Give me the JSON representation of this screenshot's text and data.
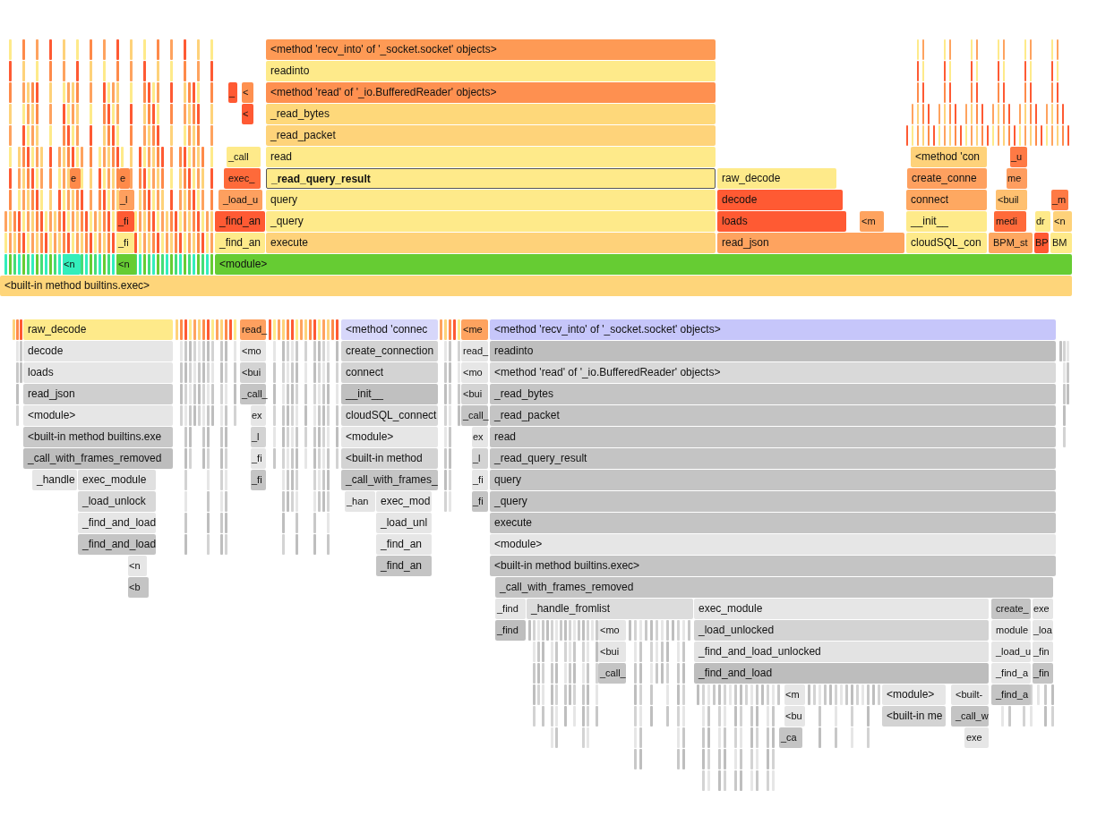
{
  "flame_graph": {
    "rows": [
      {
        "frames": [
          {
            "label": "<method 'recv_into' of '_socket.socket' objects>",
            "color": "#fe9a55",
            "selected": false
          }
        ]
      },
      {
        "frames": [
          {
            "label": "readinto",
            "color": "#feea8a",
            "selected": false
          }
        ]
      },
      {
        "frames": [
          {
            "label": "_",
            "color": "#ff5a33",
            "selected": false
          },
          {
            "label": "<",
            "color": "#fe9050",
            "selected": false
          },
          {
            "label": "<method 'read' of '_io.BufferedReader' objects>",
            "color": "#fe9050",
            "selected": false
          }
        ]
      },
      {
        "frames": [
          {
            "label": "<",
            "color": "#ff5a33",
            "selected": false
          },
          {
            "label": "_read_bytes",
            "color": "#fed87a",
            "selected": false
          }
        ]
      },
      {
        "frames": [
          {
            "label": "_read_packet",
            "color": "#fed37a",
            "selected": false
          }
        ]
      },
      {
        "frames": [
          {
            "label": "_call",
            "color": "#feea8a",
            "selected": false
          },
          {
            "label": "read",
            "color": "#feea8a",
            "selected": false
          },
          {
            "label": "<method 'con",
            "color": "#fed27a",
            "selected": false
          },
          {
            "label": "_u",
            "color": "#fe7a45",
            "selected": false
          }
        ]
      },
      {
        "frames": [
          {
            "label": "e",
            "color": "#fe8a4a",
            "selected": false
          },
          {
            "label": "e",
            "color": "#fe8a4a",
            "selected": false
          },
          {
            "label": "exec_",
            "color": "#fe6a3a",
            "selected": false
          },
          {
            "label": "_read_query_result",
            "color": "#feea8a",
            "selected": true
          },
          {
            "label": "raw_decode",
            "color": "#feea8a",
            "selected": false
          },
          {
            "label": "create_conne",
            "color": "#fea05f",
            "selected": false
          },
          {
            "label": "me",
            "color": "#fe9d5f",
            "selected": false
          }
        ]
      },
      {
        "frames": [
          {
            "label": "_l",
            "color": "#fea05f",
            "selected": false
          },
          {
            "label": "_load_u",
            "color": "#fea05f",
            "selected": false
          },
          {
            "label": "query",
            "color": "#feea8a",
            "selected": false
          },
          {
            "label": "decode",
            "color": "#ff5a33",
            "selected": false
          },
          {
            "label": "connect",
            "color": "#fea861",
            "selected": false
          },
          {
            "label": "<buil",
            "color": "#fec070",
            "selected": false
          },
          {
            "label": "_m",
            "color": "#fe7a45",
            "selected": false
          }
        ]
      },
      {
        "frames": [
          {
            "label": "_fi",
            "color": "#ff5a33",
            "selected": false
          },
          {
            "label": "_find_an",
            "color": "#ff5a33",
            "selected": false
          },
          {
            "label": "_query",
            "color": "#feea8a",
            "selected": false
          },
          {
            "label": "loads",
            "color": "#ff5a33",
            "selected": false
          },
          {
            "label": "<m",
            "color": "#fea35f",
            "selected": false
          },
          {
            "label": "__init__",
            "color": "#feea8a",
            "selected": false
          },
          {
            "label": "medi",
            "color": "#ff6a3a",
            "selected": false
          },
          {
            "label": "dr",
            "color": "#feea8a",
            "selected": false
          },
          {
            "label": "<n",
            "color": "#fed27a",
            "selected": false
          }
        ]
      },
      {
        "frames": [
          {
            "label": "_fi",
            "color": "#feea8a",
            "selected": false
          },
          {
            "label": "_find_an",
            "color": "#feea8a",
            "selected": false
          },
          {
            "label": "execute",
            "color": "#fed27a",
            "selected": false
          },
          {
            "label": "read_json",
            "color": "#fea35f",
            "selected": false
          },
          {
            "label": "cloudSQL_con",
            "color": "#feea8a",
            "selected": false
          },
          {
            "label": "BPM_st",
            "color": "#fea861",
            "selected": false
          },
          {
            "label": "BP",
            "color": "#ff5a33",
            "selected": false
          },
          {
            "label": "BM",
            "color": "#feea8a",
            "selected": false
          }
        ]
      },
      {
        "frames": [
          {
            "label": "<n",
            "color": "#33eebb",
            "selected": false
          },
          {
            "label": "<n",
            "color": "#66cc33",
            "selected": false
          },
          {
            "label": "<module>",
            "color": "#66cc33",
            "selected": false
          }
        ]
      },
      {
        "frames": [
          {
            "label": "<built-in method builtins.exec>",
            "color": "#fed57a",
            "selected": false
          }
        ]
      }
    ]
  },
  "icicle_graph": {
    "rows": [
      {
        "frames": [
          {
            "label": "raw_decode",
            "color": "#feea8a",
            "selected": false
          },
          {
            "label": "read_",
            "color": "#fea05f",
            "selected": false
          },
          {
            "label": "<method 'connec",
            "color": "#d7d7fa",
            "selected": false
          },
          {
            "label": "<me",
            "color": "#fea35f",
            "selected": false
          },
          {
            "label": "<method 'recv_into' of '_socket.socket' objects>",
            "color": "#c6c6fa",
            "selected": false
          }
        ]
      },
      {
        "frames": [
          {
            "label": "decode",
            "color": "#e6e6e6",
            "selected": false
          },
          {
            "label": "<mo",
            "color": "#e6e6e6",
            "selected": false
          },
          {
            "label": "create_connection",
            "color": "#d3d3d3",
            "selected": false
          },
          {
            "label": "read_",
            "color": "#e6e6e6",
            "selected": false
          },
          {
            "label": "readinto",
            "color": "#bebebe",
            "selected": false
          }
        ]
      },
      {
        "frames": [
          {
            "label": "loads",
            "color": "#e6e6e6",
            "selected": false
          },
          {
            "label": "<bui",
            "color": "#d3d3d3",
            "selected": false
          },
          {
            "label": "connect",
            "color": "#d3d3d3",
            "selected": false
          },
          {
            "label": "<mo",
            "color": "#e6e6e6",
            "selected": false
          },
          {
            "label": "<method 'read' of '_io.BufferedReader' objects>",
            "color": "#d9d9d9",
            "selected": false
          }
        ]
      },
      {
        "frames": [
          {
            "label": "read_json",
            "color": "#cfcfcf",
            "selected": false
          },
          {
            "label": "_call_",
            "color": "#c4c4c4",
            "selected": false
          },
          {
            "label": "__init__",
            "color": "#c0c0c0",
            "selected": false
          },
          {
            "label": "<bui",
            "color": "#d3d3d3",
            "selected": false
          },
          {
            "label": "_read_bytes",
            "color": "#c4c4c4",
            "selected": false
          }
        ]
      },
      {
        "frames": [
          {
            "label": "<module>",
            "color": "#e6e6e6",
            "selected": false
          },
          {
            "label": "ex",
            "color": "#e6e6e6",
            "selected": false
          },
          {
            "label": "cloudSQL_connect",
            "color": "#d8d8d8",
            "selected": false
          },
          {
            "label": "_call_",
            "color": "#c4c4c4",
            "selected": false
          },
          {
            "label": "_read_packet",
            "color": "#c4c4c4",
            "selected": false
          }
        ]
      },
      {
        "frames": [
          {
            "label": "<built-in method builtins.exe",
            "color": "#c8c8c8",
            "selected": false
          },
          {
            "label": "_l",
            "color": "#d3d3d3",
            "selected": false
          },
          {
            "label": "<module>",
            "color": "#e6e6e6",
            "selected": false
          },
          {
            "label": "ex",
            "color": "#e6e6e6",
            "selected": false
          },
          {
            "label": "read",
            "color": "#c4c4c4",
            "selected": false
          }
        ]
      },
      {
        "frames": [
          {
            "label": "_call_with_frames_removed",
            "color": "#bdbdbd",
            "selected": false
          },
          {
            "label": "_fi",
            "color": "#e6e6e6",
            "selected": false
          },
          {
            "label": "<built-in method",
            "color": "#d3d3d3",
            "selected": false
          },
          {
            "label": "_l",
            "color": "#d3d3d3",
            "selected": false
          },
          {
            "label": "_read_query_result",
            "color": "#c4c4c4",
            "selected": false
          }
        ]
      },
      {
        "frames": [
          {
            "label": "_handle",
            "color": "#e6e6e6",
            "selected": false
          },
          {
            "label": "exec_module",
            "color": "#e0e0e0",
            "selected": false
          },
          {
            "label": "_fi",
            "color": "#c4c4c4",
            "selected": false
          },
          {
            "label": "_call_with_frames_",
            "color": "#c4c4c4",
            "selected": false
          },
          {
            "label": "_fi",
            "color": "#e6e6e6",
            "selected": false
          },
          {
            "label": "query",
            "color": "#c4c4c4",
            "selected": false
          }
        ]
      },
      {
        "frames": [
          {
            "label": "_load_unlock",
            "color": "#d8d8d8",
            "selected": false
          },
          {
            "label": "_han",
            "color": "#e6e6e6",
            "selected": false
          },
          {
            "label": "exec_mod",
            "color": "#e6e6e6",
            "selected": false
          },
          {
            "label": "_fi",
            "color": "#c4c4c4",
            "selected": false
          },
          {
            "label": "_query",
            "color": "#c4c4c4",
            "selected": false
          }
        ]
      },
      {
        "frames": [
          {
            "label": "_find_and_load",
            "color": "#e6e6e6",
            "selected": false
          },
          {
            "label": "_load_unl",
            "color": "#e6e6e6",
            "selected": false
          },
          {
            "label": "execute",
            "color": "#c4c4c4",
            "selected": false
          }
        ]
      },
      {
        "frames": [
          {
            "label": "_find_and_load",
            "color": "#c4c4c4",
            "selected": false
          },
          {
            "label": "_find_an",
            "color": "#e6e6e6",
            "selected": false
          },
          {
            "label": "<module>",
            "color": "#e6e6e6",
            "selected": false
          }
        ]
      },
      {
        "frames": [
          {
            "label": "<n",
            "color": "#e6e6e6",
            "selected": false
          },
          {
            "label": "_find_an",
            "color": "#c4c4c4",
            "selected": false
          },
          {
            "label": "<built-in method builtins.exec>",
            "color": "#c4c4c4",
            "selected": false
          }
        ]
      },
      {
        "frames": [
          {
            "label": "<b",
            "color": "#c4c4c4",
            "selected": false
          },
          {
            "label": "_call_with_frames_removed",
            "color": "#c4c4c4",
            "selected": false
          }
        ]
      },
      {
        "frames": [
          {
            "label": "_find",
            "color": "#e6e6e6",
            "selected": false
          },
          {
            "label": "_handle_fromlist",
            "color": "#dcdcdc",
            "selected": false
          },
          {
            "label": "exec_module",
            "color": "#e6e6e6",
            "selected": false
          },
          {
            "label": "create_",
            "color": "#c4c4c4",
            "selected": false
          },
          {
            "label": "exe",
            "color": "#e6e6e6",
            "selected": false
          }
        ]
      },
      {
        "frames": [
          {
            "label": "_find",
            "color": "#bebebe",
            "selected": false
          },
          {
            "label": "<mo",
            "color": "#e6e6e6",
            "selected": false
          },
          {
            "label": "_load_unlocked",
            "color": "#d3d3d3",
            "selected": false
          },
          {
            "label": "module",
            "color": "#e6e6e6",
            "selected": false
          },
          {
            "label": "_loa",
            "color": "#e6e6e6",
            "selected": false
          }
        ]
      },
      {
        "frames": [
          {
            "label": "<bui",
            "color": "#e6e6e6",
            "selected": false
          },
          {
            "label": "_find_and_load_unlocked",
            "color": "#e3e3e3",
            "selected": false
          },
          {
            "label": "_load_u",
            "color": "#e6e6e6",
            "selected": false
          },
          {
            "label": "_fin",
            "color": "#e6e6e6",
            "selected": false
          }
        ]
      },
      {
        "frames": [
          {
            "label": "_call_",
            "color": "#c4c4c4",
            "selected": false
          },
          {
            "label": "_find_and_load",
            "color": "#bdbdbd",
            "selected": false
          },
          {
            "label": "_find_a",
            "color": "#e6e6e6",
            "selected": false
          },
          {
            "label": "_fin",
            "color": "#c4c4c4",
            "selected": false
          }
        ]
      },
      {
        "frames": [
          {
            "label": "<m",
            "color": "#e6e6e6",
            "selected": false
          },
          {
            "label": "<module>",
            "color": "#e6e6e6",
            "selected": false
          },
          {
            "label": "<built-",
            "color": "#e6e6e6",
            "selected": false
          },
          {
            "label": "_find_a",
            "color": "#c4c4c4",
            "selected": false
          }
        ]
      },
      {
        "frames": [
          {
            "label": "<bu",
            "color": "#e6e6e6",
            "selected": false
          },
          {
            "label": "<built-in me",
            "color": "#d3d3d3",
            "selected": false
          },
          {
            "label": "_call_w",
            "color": "#c4c4c4",
            "selected": false
          }
        ]
      },
      {
        "frames": [
          {
            "label": "_ca",
            "color": "#c4c4c4",
            "selected": false
          },
          {
            "label": "exe",
            "color": "#e6e6e6",
            "selected": false
          }
        ]
      }
    ]
  }
}
